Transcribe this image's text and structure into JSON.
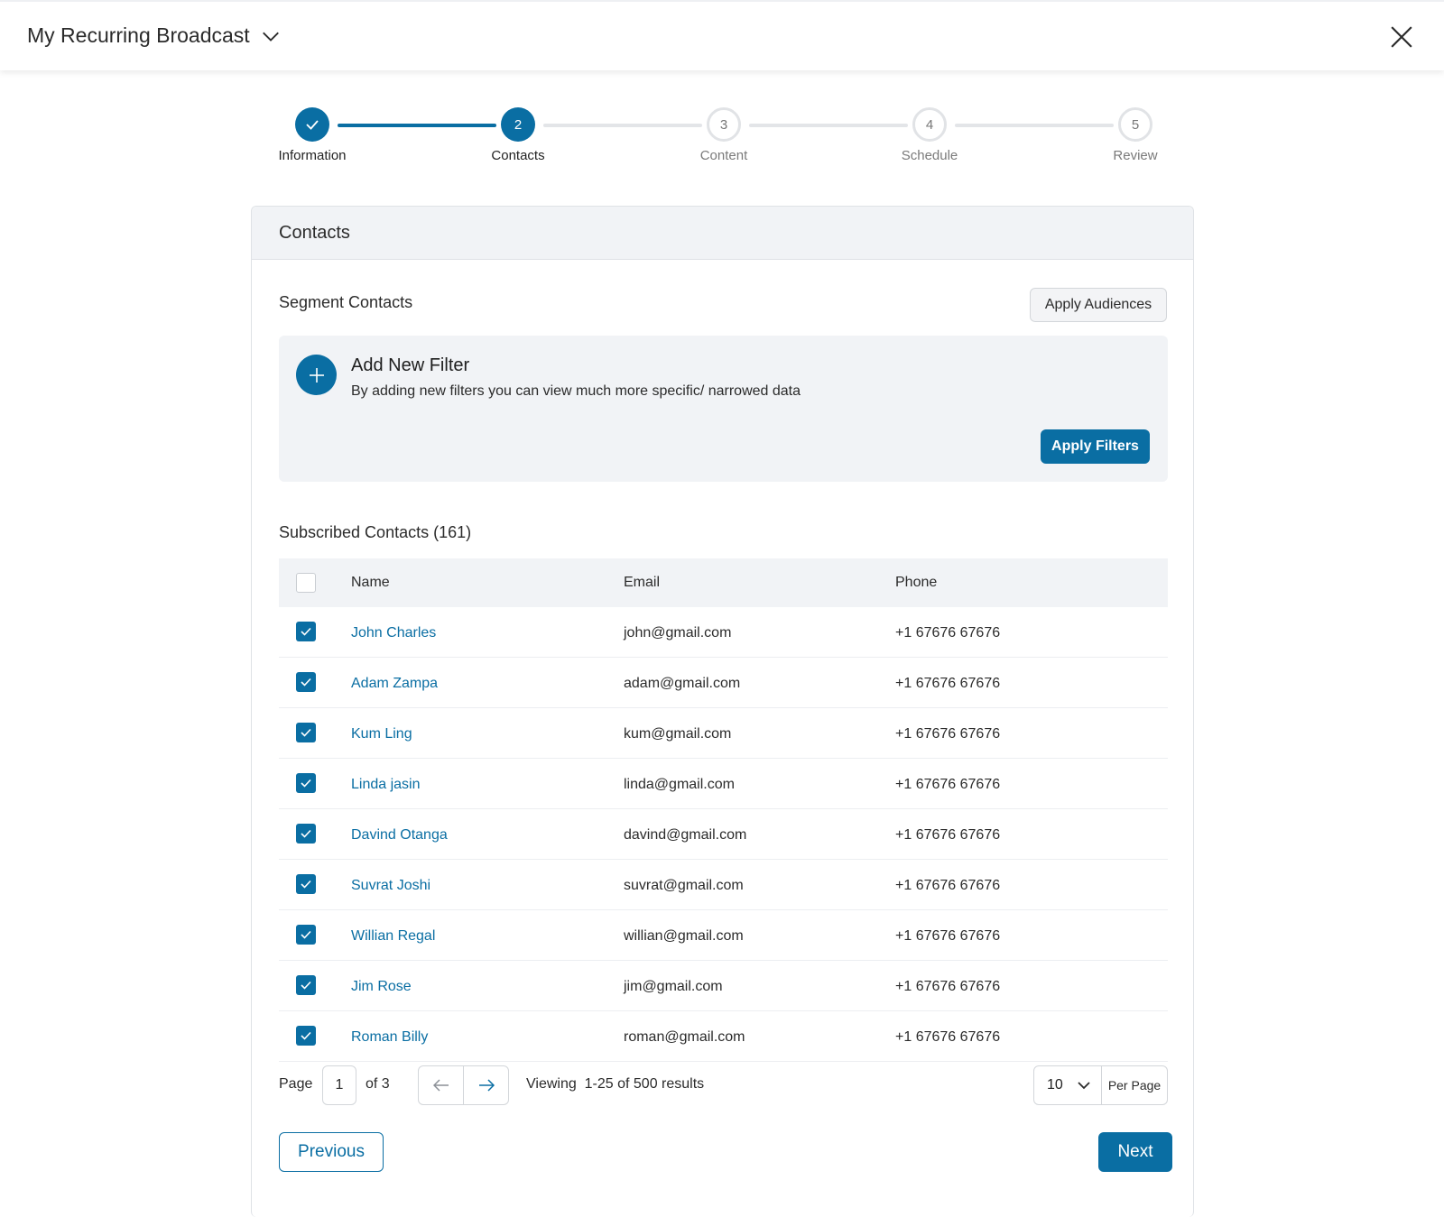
{
  "header": {
    "title": "My Recurring Broadcast"
  },
  "stepper": {
    "steps": [
      {
        "label": "Information",
        "number": "",
        "state": "done"
      },
      {
        "label": "Contacts",
        "number": "2",
        "state": "active"
      },
      {
        "label": "Content",
        "number": "3",
        "state": "pending"
      },
      {
        "label": "Schedule",
        "number": "4",
        "state": "pending"
      },
      {
        "label": "Review",
        "number": "5",
        "state": "pending"
      }
    ]
  },
  "card": {
    "title": "Contacts",
    "segment_title": "Segment Contacts",
    "apply_audiences_label": "Apply Audiences",
    "filter": {
      "title": "Add New Filter",
      "subtitle": "By adding new filters you can view much more specific/ narrowed data",
      "apply_label": "Apply Filters"
    },
    "subscribed_title": "Subscribed Contacts (161)"
  },
  "table": {
    "columns": {
      "name": "Name",
      "email": "Email",
      "phone": "Phone"
    },
    "rows": [
      {
        "name": "John Charles",
        "email": "john@gmail.com",
        "phone": "+1 67676 67676",
        "checked": true
      },
      {
        "name": "Adam Zampa",
        "email": "adam@gmail.com",
        "phone": "+1 67676 67676",
        "checked": true
      },
      {
        "name": "Kum Ling",
        "email": "kum@gmail.com",
        "phone": "+1 67676 67676",
        "checked": true
      },
      {
        "name": "Linda jasin",
        "email": "linda@gmail.com",
        "phone": "+1 67676 67676",
        "checked": true
      },
      {
        "name": "Davind Otanga",
        "email": "davind@gmail.com",
        "phone": "+1 67676 67676",
        "checked": true
      },
      {
        "name": "Suvrat Joshi",
        "email": "suvrat@gmail.com",
        "phone": "+1 67676 67676",
        "checked": true
      },
      {
        "name": "Willian Regal",
        "email": "willian@gmail.com",
        "phone": "+1 67676 67676",
        "checked": true
      },
      {
        "name": "Jim Rose",
        "email": "jim@gmail.com",
        "phone": "+1 67676 67676",
        "checked": true
      },
      {
        "name": "Roman Billy",
        "email": "roman@gmail.com",
        "phone": "+1 67676 67676",
        "checked": true
      }
    ]
  },
  "pagination": {
    "page_label": "Page",
    "page_value": "1",
    "of_label": "of 3",
    "viewing_text": "Viewing  1-25 of 500 results",
    "per_page_value": "10",
    "per_page_label": "Per Page"
  },
  "footer": {
    "previous_label": "Previous",
    "next_label": "Next"
  },
  "colors": {
    "accent": "#0a6ea3",
    "panel": "#f1f3f6"
  }
}
